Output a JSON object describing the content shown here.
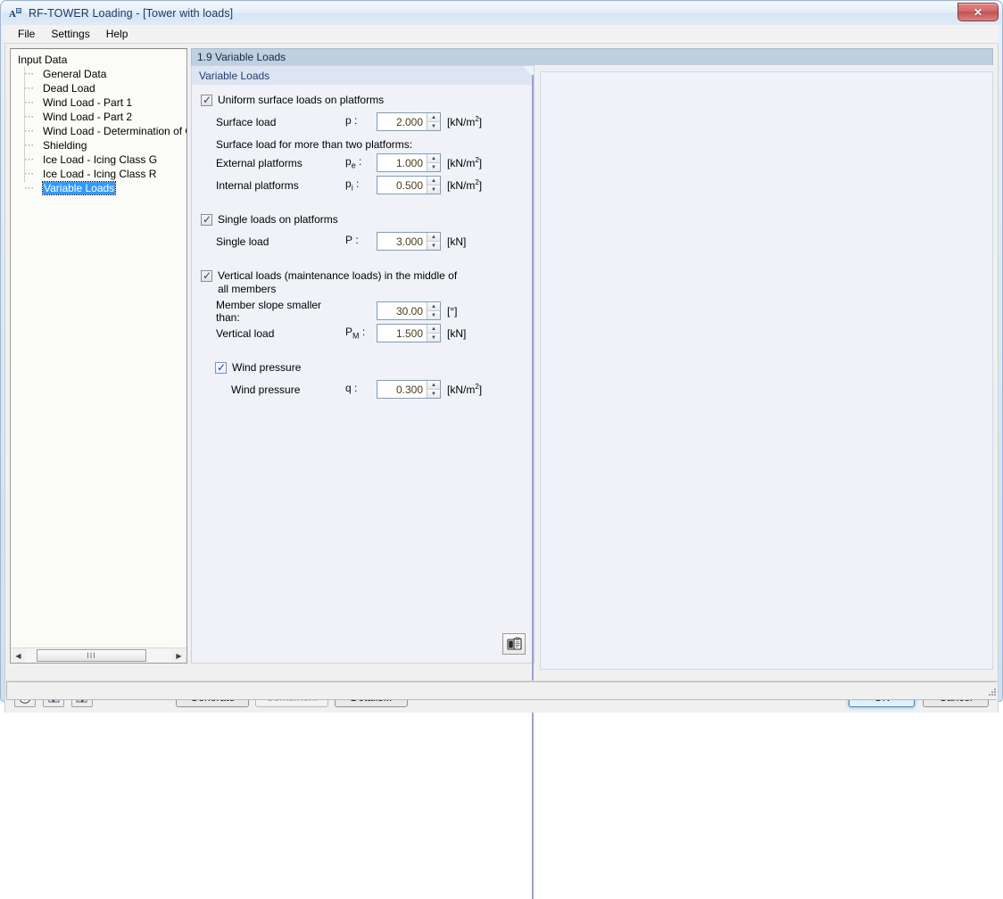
{
  "window": {
    "title": "RF-TOWER Loading - [Tower with loads]",
    "app_icon": "tower-app-icon",
    "close_label": "✕"
  },
  "menubar": {
    "items": [
      {
        "label": "File"
      },
      {
        "label": "Settings"
      },
      {
        "label": "Help"
      }
    ]
  },
  "sidebar": {
    "root": "Input Data",
    "items": [
      {
        "label": "General Data",
        "selected": false
      },
      {
        "label": "Dead Load",
        "selected": false
      },
      {
        "label": "Wind Load - Part 1",
        "selected": false
      },
      {
        "label": "Wind Load - Part 2",
        "selected": false
      },
      {
        "label": "Wind Load - Determination of Gust",
        "selected": false
      },
      {
        "label": "Shielding",
        "selected": false
      },
      {
        "label": "Ice Load - Icing Class G",
        "selected": false
      },
      {
        "label": "Ice Load - Icing Class R",
        "selected": false
      },
      {
        "label": "Variable Loads",
        "selected": true
      }
    ],
    "scrollbar": {
      "left_arrow": "◀",
      "right_arrow": "▶",
      "grip": "III"
    }
  },
  "main": {
    "section_header": "1.9 Variable Loads",
    "group_title": "Variable Loads",
    "checkboxes": {
      "uniform_surface": {
        "label": "Uniform surface loads on platforms",
        "checked": true
      },
      "single_loads": {
        "label": "Single loads on platforms",
        "checked": true
      },
      "vertical_loads": {
        "label": "Vertical loads (maintenance loads) in the middle of all members",
        "checked": true
      },
      "wind_pressure": {
        "label": "Wind pressure",
        "checked": true
      }
    },
    "note_more_platforms": "Surface load for more than two platforms:",
    "fields": [
      {
        "name": "surface-load",
        "label": "Surface load",
        "symbol": "p",
        "sub": "",
        "value": "2.000",
        "unit": "kN/m",
        "unit_sup": "2"
      },
      {
        "name": "external-platforms",
        "label": "External platforms",
        "symbol": "p",
        "sub": "e",
        "value": "1.000",
        "unit": "kN/m",
        "unit_sup": "2"
      },
      {
        "name": "internal-platforms",
        "label": "Internal platforms",
        "symbol": "p",
        "sub": "i",
        "value": "0.500",
        "unit": "kN/m",
        "unit_sup": "2"
      },
      {
        "name": "single-load",
        "label": "Single load",
        "symbol": "P",
        "sub": "",
        "value": "3.000",
        "unit": "kN",
        "unit_sup": ""
      },
      {
        "name": "member-slope",
        "label": "Member slope smaller than:",
        "symbol": "",
        "sub": "",
        "value": "30.00",
        "unit": "°",
        "unit_sup": ""
      },
      {
        "name": "vertical-load",
        "label": "Vertical load",
        "symbol": "P",
        "sub": "M",
        "value": "1.500",
        "unit": "kN",
        "unit_sup": ""
      },
      {
        "name": "wind-pressure",
        "label": "Wind pressure",
        "symbol": "q",
        "sub": "",
        "value": "0.300",
        "unit": "kN/m",
        "unit_sup": "2"
      }
    ],
    "spinner": {
      "up": "▲",
      "down": "▼"
    },
    "clipboard_icon": "clipboard-icon"
  },
  "bottom": {
    "tools": [
      {
        "name": "help-icon",
        "glyph": "?"
      },
      {
        "name": "previous-arrow-icon",
        "glyph": "◀"
      },
      {
        "name": "next-arrow-icon",
        "glyph": "▶"
      }
    ],
    "buttons": [
      {
        "name": "generate-button",
        "label": "Generate",
        "disabled": false
      },
      {
        "name": "combine-button",
        "label": "Combine...",
        "disabled": true
      },
      {
        "name": "details-button",
        "label": "Details...",
        "disabled": false
      }
    ],
    "ok_label": "OK",
    "cancel_label": "Cancel"
  },
  "colors": {
    "accent": "#3399ff",
    "title_text": "#1b3a63",
    "group_header": "#dde5f2",
    "section_header": "#bfd0e0",
    "value_text": "#4a3c14"
  }
}
